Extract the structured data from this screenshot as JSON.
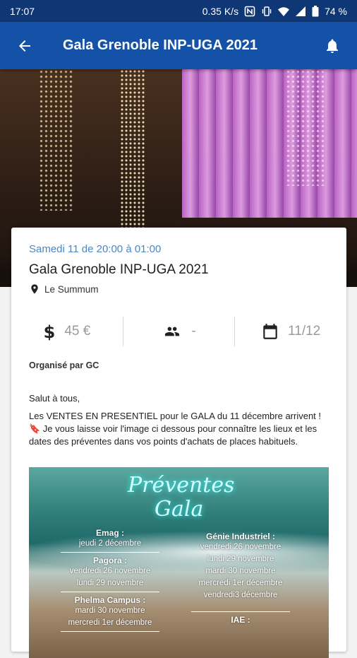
{
  "status_bar": {
    "time": "17:07",
    "network_speed": "0.35 K/s",
    "battery": "74 %"
  },
  "app_bar": {
    "title": "Gala Grenoble INP-UGA 2021",
    "back_icon": "arrow-back-icon",
    "bell_icon": "bell-icon"
  },
  "event": {
    "date_text": "Samedi 11 de 20:00 à 01:00",
    "title": "Gala Grenoble INP-UGA 2021",
    "location": "Le Summum",
    "price": "45 €",
    "capacity": "-",
    "date_short": "11/12",
    "organizer": "Organisé par GC",
    "greeting": "Salut à tous,",
    "description": "Les VENTES EN PRESENTIEL pour le GALA du 11 décembre arrivent ! 🔖 Je vous laisse voir l'image ci dessous pour connaître les lieux et les dates des préventes dans vos points d'achats de places habituels."
  },
  "poster": {
    "title_line1": "Préventes",
    "title_line2": "Gala",
    "left_column": [
      {
        "place": "Emag :",
        "dates": [
          "jeudi 2 décembre"
        ]
      },
      {
        "place": "Pagora :",
        "dates": [
          "vendredi 26 novembre",
          "lundi 29 novembre"
        ]
      },
      {
        "place": "Phelma Campus :",
        "dates": [
          "mardi 30 novembre",
          "mercredi 1er décembre"
        ]
      }
    ],
    "right_column": [
      {
        "place": "Génie Industriel :",
        "dates": [
          "vendredi 26 novembre",
          "lundi 29 novembre",
          "mardi 30 novembre",
          "mercredi 1er décembre",
          "vendredi3 décembre"
        ]
      },
      {
        "place": "IAE :",
        "dates": []
      }
    ]
  },
  "colors": {
    "status_bar": "#0f3775",
    "app_bar": "#1452a8",
    "date_accent": "#4a86c5"
  }
}
